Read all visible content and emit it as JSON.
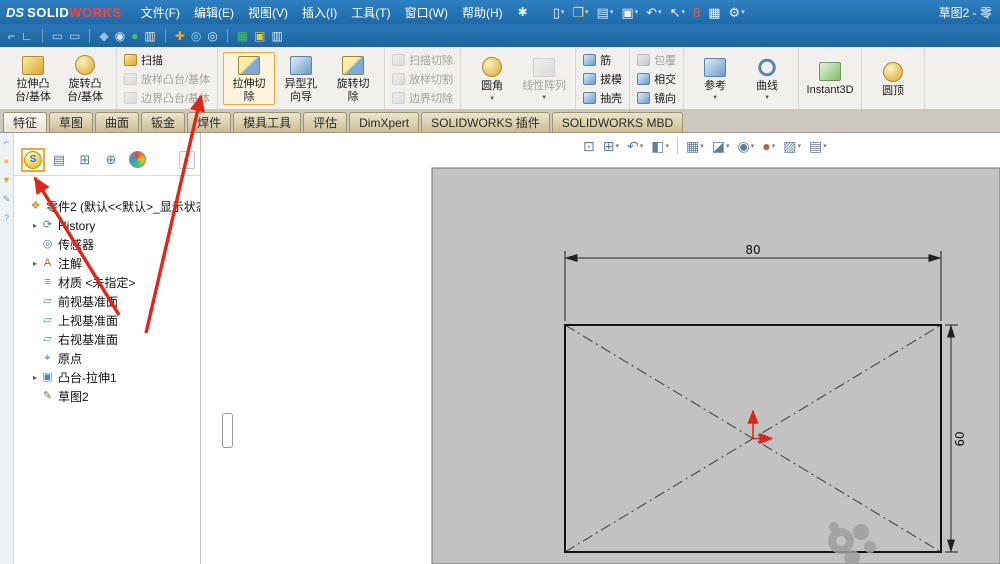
{
  "colors": {
    "titlebar_blue": "#2173b5",
    "ribbon_bg": "#f1f0ec",
    "tab_tan": "#cbbd92",
    "highlight_orange": "#f0a73c",
    "annotation_red": "#e02519",
    "model_face_gray": "#c2c2c2",
    "logo_works_red": "#ff4136"
  },
  "titlebar": {
    "logo": {
      "ds": "DS",
      "solid": "SOLID",
      "works": "WORKS"
    },
    "menus": [
      {
        "name": "menu-file",
        "label": "文件(F)"
      },
      {
        "name": "menu-edit",
        "label": "编辑(E)"
      },
      {
        "name": "menu-view",
        "label": "视图(V)"
      },
      {
        "name": "menu-insert",
        "label": "插入(I)"
      },
      {
        "name": "menu-tools",
        "label": "工具(T)"
      },
      {
        "name": "menu-window",
        "label": "窗口(W)"
      },
      {
        "name": "menu-help",
        "label": "帮助(H)"
      }
    ],
    "star_icon": "✱",
    "quick_icons": [
      {
        "name": "new-document-icon",
        "glyph": "▯",
        "color": "#eaf3fb",
        "caret": true
      },
      {
        "name": "open-icon",
        "glyph": "❒",
        "color": "#f6d56a",
        "caret": true
      },
      {
        "name": "save-icon",
        "glyph": "▤",
        "color": "#cfe4f7",
        "caret": true
      },
      {
        "name": "print-icon",
        "glyph": "▣",
        "color": "#eaf3fb",
        "caret": true
      },
      {
        "name": "undo-icon",
        "glyph": "↶",
        "color": "#eaf3fb",
        "caret": true
      },
      {
        "name": "select-icon",
        "glyph": "↖",
        "color": "#eaf3fb",
        "caret": true
      },
      {
        "name": "rebuild-icon",
        "glyph": "8",
        "color": "#e2574c",
        "caret": false
      },
      {
        "name": "file-properties-icon",
        "glyph": "▦",
        "color": "#eaf3fb",
        "caret": false
      },
      {
        "name": "options-gear-icon",
        "glyph": "⚙",
        "color": "#eaf3fb",
        "caret": true
      }
    ],
    "document_title": "草图2 - 零"
  },
  "toolbar2": {
    "icons": [
      {
        "name": "pin-icon",
        "glyph": "⌐",
        "color": "#d8e9f8"
      },
      {
        "name": "corner-ruler-icon",
        "glyph": "∟",
        "color": "#d8e9f8",
        "sep_after": true
      },
      {
        "name": "monitor1-icon",
        "glyph": "▭",
        "color": "#a8d4f5"
      },
      {
        "name": "monitor2-icon",
        "glyph": "▭",
        "color": "#a8d4f5",
        "sep_after": true
      },
      {
        "name": "appearance-icon",
        "glyph": "◆",
        "color": "#9fc3e3"
      },
      {
        "name": "eye-icon",
        "glyph": "◉",
        "color": "#d8e9f8"
      },
      {
        "name": "sphere-icon",
        "glyph": "●",
        "color": "#46c05a"
      },
      {
        "name": "mm-ruler-icon",
        "glyph": "▥",
        "color": "#e8e2c8",
        "sep_after": true
      },
      {
        "name": "add-icon",
        "glyph": "✚",
        "color": "#f2a33a"
      },
      {
        "name": "zoom-pair-icon",
        "glyph": "◎",
        "color": "#a8d4f5"
      },
      {
        "name": "magnifier-icon",
        "glyph": "◎",
        "color": "#d8e9f8",
        "sep_after": true
      },
      {
        "name": "table-icon",
        "glyph": "▦",
        "color": "#46c05a"
      },
      {
        "name": "cart-icon",
        "glyph": "▣",
        "color": "#e8c63f"
      },
      {
        "name": "sheet-icon",
        "glyph": "▥",
        "color": "#d8e9f8"
      }
    ]
  },
  "ribbon": {
    "groups": [
      {
        "name": "boss-base-group",
        "type": "large",
        "items": [
          {
            "name": "extruded-boss-button",
            "label": "拉伸凸\n台/基体",
            "icon": "gold"
          },
          {
            "name": "revolved-boss-button",
            "label": "旋转凸\n台/基体",
            "icon": "gold-round"
          }
        ]
      },
      {
        "name": "boss-advanced-group",
        "type": "stack",
        "items": [
          {
            "name": "swept-boss-button",
            "label": "扫描",
            "icon": "gold"
          },
          {
            "name": "lofted-boss-button",
            "label": "放样凸台/基体",
            "icon": "gray",
            "disabled": true
          },
          {
            "name": "boundary-boss-button",
            "label": "边界凸台/基体",
            "icon": "gray",
            "disabled": true
          }
        ]
      },
      {
        "name": "cut-group",
        "type": "large",
        "items": [
          {
            "name": "extruded-cut-button",
            "label": "拉伸切\n除",
            "icon": "goldblue",
            "highlight": true
          },
          {
            "name": "hole-wizard-button",
            "label": "异型孔\n向导",
            "icon": "blue"
          },
          {
            "name": "revolved-cut-button",
            "label": "旋转切\n除",
            "icon": "goldblue"
          }
        ]
      },
      {
        "name": "cut-advanced-group",
        "type": "stack",
        "items": [
          {
            "name": "swept-cut-button",
            "label": "扫描切除",
            "icon": "gray",
            "disabled": true
          },
          {
            "name": "lofted-cut-button",
            "label": "放样切割",
            "icon": "gray",
            "disabled": true
          },
          {
            "name": "boundary-cut-button",
            "label": "边界切除",
            "icon": "gray",
            "disabled": true
          }
        ]
      },
      {
        "name": "fillet-pattern-group",
        "type": "large",
        "items": [
          {
            "name": "fillet-button",
            "label": "圆角",
            "icon": "gold-round",
            "caret": true
          },
          {
            "name": "linear-pattern-button",
            "label": "线性阵列",
            "icon": "gray",
            "disabled": true,
            "caret": true
          }
        ]
      },
      {
        "name": "rib-draft-shell-group",
        "type": "stack",
        "items": [
          {
            "name": "rib-button",
            "label": "筋",
            "icon": "blue"
          },
          {
            "name": "draft-button",
            "label": "拔模",
            "icon": "blue"
          },
          {
            "name": "shell-button",
            "label": "抽壳",
            "icon": "blue"
          }
        ]
      },
      {
        "name": "wrap-intersect-mirror-group",
        "type": "stack",
        "items": [
          {
            "name": "wrap-button",
            "label": "包覆",
            "icon": "blue",
            "disabled": true
          },
          {
            "name": "intersect-button",
            "label": "相交",
            "icon": "blue"
          },
          {
            "name": "mirror-button",
            "label": "镜向",
            "icon": "blue"
          }
        ]
      },
      {
        "name": "reference-curve-group",
        "type": "large",
        "items": [
          {
            "name": "reference-geometry-button",
            "label": "参考",
            "icon": "blue",
            "caret": true
          },
          {
            "name": "curves-button",
            "label": "曲线",
            "icon": "curve",
            "caret": true
          }
        ]
      },
      {
        "name": "instant3d-group",
        "type": "large",
        "items": [
          {
            "name": "instant3d-button",
            "label": "Instant3D",
            "icon": "instant"
          }
        ]
      },
      {
        "name": "dome-group",
        "type": "large",
        "items": [
          {
            "name": "dome-button",
            "label": "圆顶",
            "icon": "gold-round"
          }
        ]
      }
    ]
  },
  "tabs": {
    "items": [
      {
        "name": "tab-features",
        "label": "特征",
        "active": true
      },
      {
        "name": "tab-sketch",
        "label": "草图"
      },
      {
        "name": "tab-surfaces",
        "label": "曲面"
      },
      {
        "name": "tab-sheet-metal",
        "label": "钣金"
      },
      {
        "name": "tab-weldments",
        "label": "焊件"
      },
      {
        "name": "tab-mold-tools",
        "label": "模具工具"
      },
      {
        "name": "tab-evaluate",
        "label": "评估"
      },
      {
        "name": "tab-dimxpert",
        "label": "DimXpert"
      },
      {
        "name": "tab-solidworks-addins",
        "label": "SOLIDWORKS 插件"
      },
      {
        "name": "tab-solidworks-mbd",
        "label": "SOLIDWORKS MBD"
      }
    ]
  },
  "left_strip": {
    "icons": [
      {
        "name": "pin-strip-icon",
        "glyph": "⌐",
        "color": "#7a93ad"
      },
      {
        "name": "resources-strip-icon",
        "glyph": "●",
        "color": "#f0c23a"
      },
      {
        "name": "filter-strip-icon",
        "glyph": "▼",
        "color": "#d9a62e"
      },
      {
        "name": "pencil-strip-icon",
        "glyph": "✎",
        "color": "#7a93ad"
      },
      {
        "name": "help-strip-icon",
        "glyph": "?",
        "color": "#7a93ad"
      }
    ]
  },
  "tree_panel": {
    "tabs": [
      {
        "name": "featuremanager-tab",
        "kind": "sball",
        "glyph": "S",
        "highlight": true
      },
      {
        "name": "propertymanager-tab",
        "kind": "glyph",
        "glyph": "▤"
      },
      {
        "name": "configurationmanager-tab",
        "kind": "glyph",
        "glyph": "⊞"
      },
      {
        "name": "dimxpertmanager-tab",
        "kind": "glyph",
        "glyph": "⊕"
      },
      {
        "name": "displaymanager-tab",
        "kind": "ball"
      }
    ],
    "flyout": "›",
    "icon_glyphs": {
      "part": "❖",
      "history": "⟳",
      "sensors": "◎",
      "annotations": "A",
      "material": "≡",
      "plane": "▱",
      "origin": "⌖",
      "extrude": "▣",
      "sketch": "✎"
    },
    "icon_colors": {
      "part": "#c6962f",
      "history": "#4a7aa8",
      "sensors": "#4a7aa8",
      "annotations": "#a0672c",
      "material": "#7a8a99",
      "plane": "#4a86c8",
      "origin": "#50719a",
      "extrude": "#4a86c8",
      "sketch": "#8a6d3b"
    },
    "items": [
      {
        "name": "tree-item-part",
        "label": "零件2 (默认<<默认>_显示状态",
        "icon": "part",
        "level": 0,
        "arrow": ""
      },
      {
        "name": "tree-item-history",
        "label": "History",
        "icon": "history",
        "level": 1,
        "arrow": "▸"
      },
      {
        "name": "tree-item-sensors",
        "label": "传感器",
        "icon": "sensors",
        "level": 1,
        "arrow": ""
      },
      {
        "name": "tree-item-annotations",
        "label": "注解",
        "icon": "annotations",
        "level": 1,
        "arrow": "▸"
      },
      {
        "name": "tree-item-material",
        "label": "材质 <未指定>",
        "icon": "material",
        "level": 1,
        "arrow": ""
      },
      {
        "name": "tree-item-front-plane",
        "label": "前视基准面",
        "icon": "plane",
        "level": 1,
        "arrow": ""
      },
      {
        "name": "tree-item-top-plane",
        "label": "上视基准面",
        "icon": "plane",
        "level": 1,
        "arrow": ""
      },
      {
        "name": "tree-item-right-plane",
        "label": "右视基准面",
        "icon": "plane",
        "level": 1,
        "arrow": ""
      },
      {
        "name": "tree-item-origin",
        "label": "原点",
        "icon": "origin",
        "level": 1,
        "arrow": ""
      },
      {
        "name": "tree-item-boss-extrude1",
        "label": "凸台-拉伸1",
        "icon": "extrude",
        "level": 1,
        "arrow": "▸"
      },
      {
        "name": "tree-item-sketch2",
        "label": "草图2",
        "icon": "sketch",
        "level": 1,
        "arrow": ""
      }
    ]
  },
  "viewport": {
    "headsup": [
      {
        "name": "zoom-fit-icon",
        "glyph": "⊡"
      },
      {
        "name": "zoom-area-icon",
        "glyph": "⊞",
        "caret": true
      },
      {
        "name": "previous-view-icon",
        "glyph": "↶",
        "caret": true
      },
      {
        "name": "section-view-icon",
        "glyph": "◧",
        "caret": true
      },
      {
        "sep": true
      },
      {
        "name": "view-orientation-icon",
        "glyph": "▦",
        "caret": true
      },
      {
        "name": "display-style-icon",
        "glyph": "◪",
        "caret": true
      },
      {
        "name": "hide-show-items-icon",
        "glyph": "◉",
        "caret": true
      },
      {
        "name": "edit-appearance-icon",
        "glyph": "●",
        "caret": true,
        "color": "#c55a3a"
      },
      {
        "name": "apply-scene-icon",
        "glyph": "▨",
        "caret": true
      },
      {
        "name": "view-settings-icon",
        "glyph": "▤",
        "caret": true
      }
    ],
    "sketch": {
      "dim_width": "80",
      "dim_height": "60"
    }
  }
}
